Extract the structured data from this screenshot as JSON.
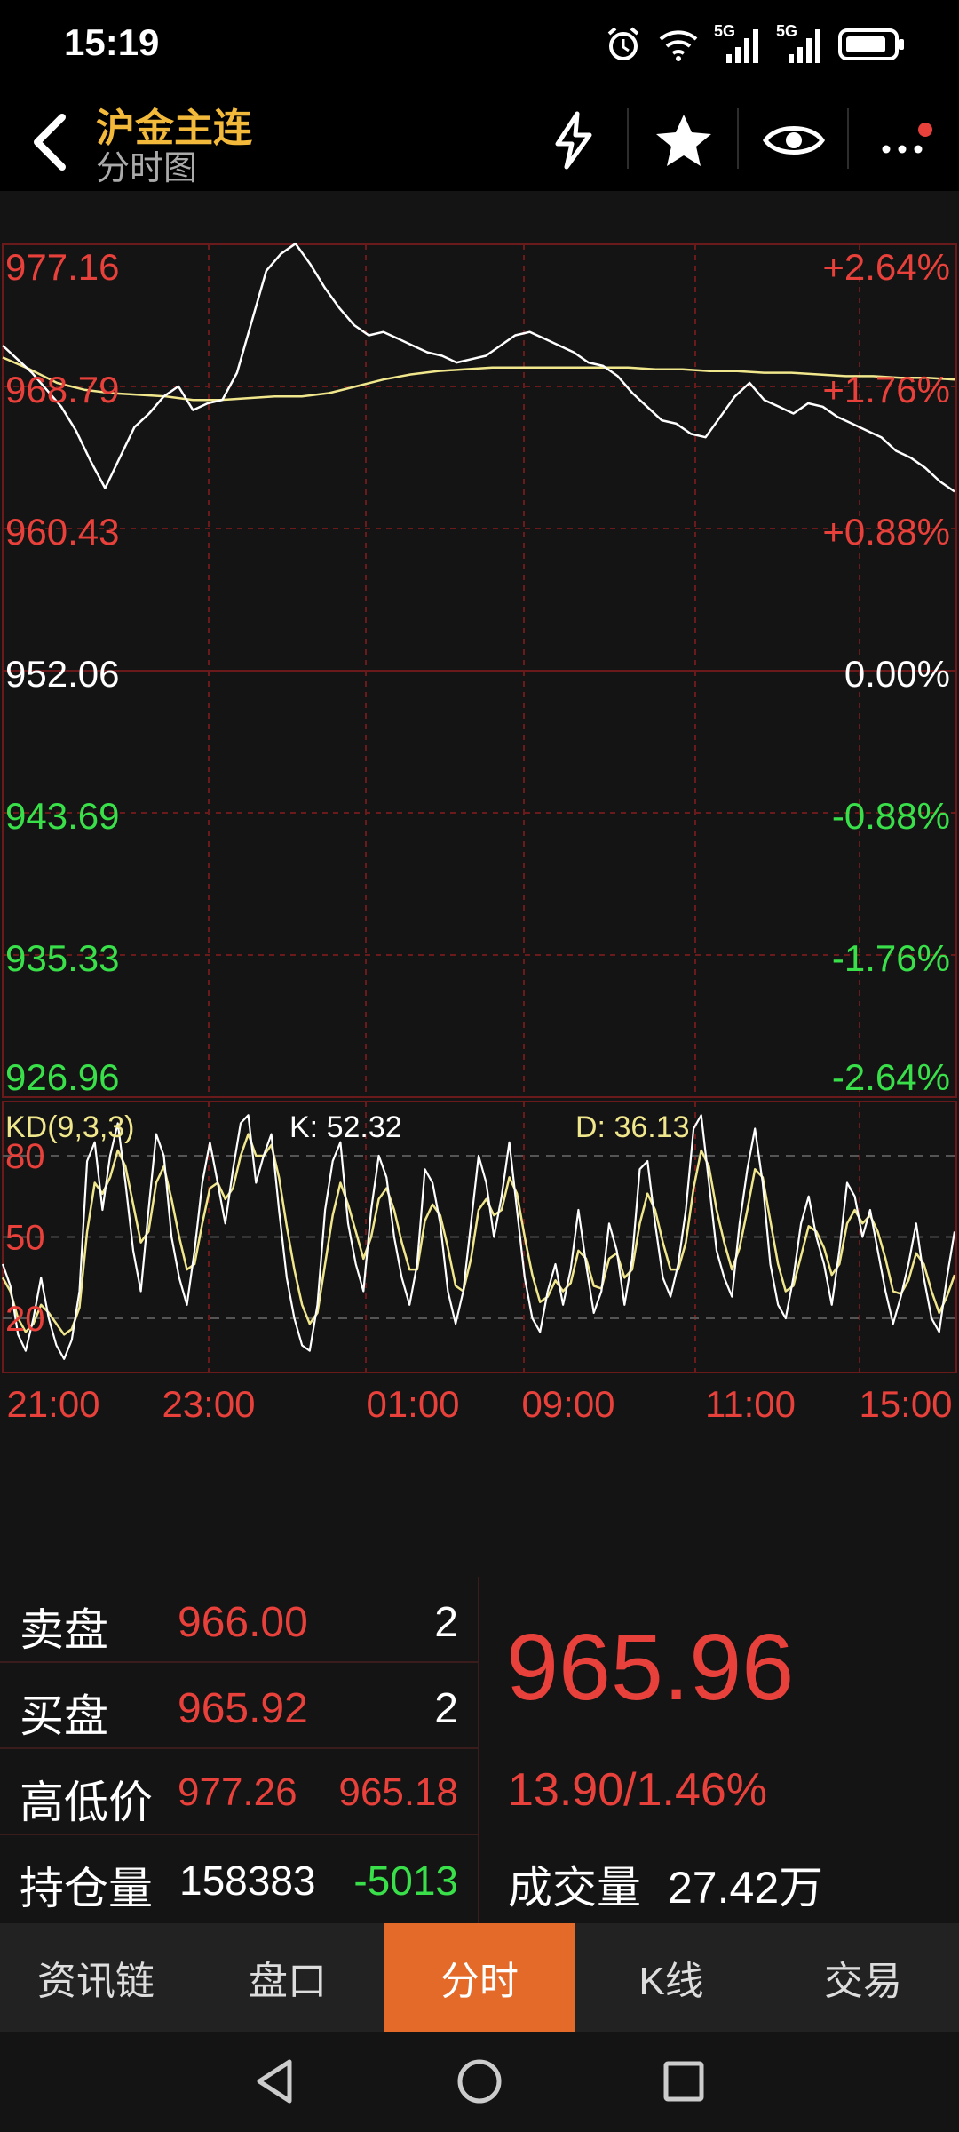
{
  "status": {
    "time": "15:19",
    "net1": "5G",
    "net2": "5G"
  },
  "header": {
    "title": "沪金主连",
    "subtitle": "分时图"
  },
  "chart_data": {
    "type": "line",
    "price_levels": [
      "977.16",
      "968.79",
      "960.43",
      "952.06",
      "943.69",
      "935.33",
      "926.96"
    ],
    "pct_levels": [
      "+2.64%",
      "+1.76%",
      "+0.88%",
      "0.00%",
      "-0.88%",
      "-1.76%",
      "-2.64%"
    ],
    "level_colors": [
      "#E8403A",
      "#E8403A",
      "#E8403A",
      "#ffffff",
      "#39E04A",
      "#39E04A",
      "#39E04A"
    ],
    "ylim": [
      926.96,
      977.16
    ],
    "time_labels": [
      "21:00",
      "23:00",
      "01:00",
      "09:00",
      "11:00",
      "15:00"
    ],
    "series": [
      {
        "values": [
          971.2,
          970.4,
          969.6,
          968.6,
          967.6,
          966.2,
          964.4,
          962.8,
          964.6,
          966.4,
          967.2,
          968.2,
          968.8,
          967.4,
          967.8,
          968.0,
          969.6,
          972.6,
          975.6,
          976.6,
          977.2,
          976.0,
          974.6,
          973.4,
          972.4,
          971.8,
          972.0,
          971.6,
          971.2,
          970.8,
          970.6,
          970.2,
          970.4,
          970.6,
          971.2,
          971.8,
          972.0,
          971.6,
          971.2,
          970.8,
          970.2,
          970.0,
          969.4,
          968.4,
          967.6,
          966.8,
          966.6,
          966.0,
          965.8,
          967.0,
          968.2,
          969.0,
          968.0,
          967.6,
          967.2,
          967.8,
          967.6,
          967.0,
          966.6,
          966.2,
          965.8,
          965.0,
          964.6,
          964.0,
          963.2,
          962.6
        ]
      },
      {
        "values": [
          970.5,
          969.8,
          969.0,
          968.6,
          968.4,
          968.3,
          968.2,
          968.0,
          968.0,
          968.1,
          968.2,
          968.2,
          968.4,
          968.8,
          969.2,
          969.5,
          969.7,
          969.8,
          969.9,
          969.9,
          969.9,
          969.9,
          969.9,
          969.9,
          969.8,
          969.8,
          969.7,
          969.7,
          969.6,
          969.6,
          969.5,
          969.4,
          969.4,
          969.3,
          969.3,
          969.2
        ]
      }
    ],
    "kd": {
      "label": "KD(9,3,3)",
      "k_label": "K: 52.32",
      "d_label": "D: 36.13",
      "levels": [
        "80",
        "50",
        "20"
      ],
      "ylim": [
        0,
        100
      ],
      "k": [
        40,
        32,
        14,
        8,
        20,
        35,
        20,
        10,
        5,
        12,
        30,
        78,
        85,
        60,
        80,
        92,
        70,
        45,
        30,
        60,
        88,
        80,
        50,
        35,
        25,
        45,
        70,
        85,
        70,
        55,
        75,
        92,
        95,
        70,
        80,
        88,
        60,
        35,
        20,
        10,
        8,
        25,
        60,
        78,
        85,
        55,
        40,
        30,
        60,
        80,
        72,
        50,
        35,
        25,
        40,
        75,
        70,
        55,
        30,
        18,
        30,
        55,
        80,
        70,
        50,
        65,
        85,
        60,
        35,
        20,
        15,
        30,
        40,
        25,
        38,
        60,
        40,
        22,
        30,
        55,
        45,
        25,
        42,
        75,
        78,
        55,
        35,
        28,
        40,
        60,
        90,
        95,
        70,
        45,
        35,
        28,
        55,
        75,
        90,
        70,
        40,
        25,
        20,
        35,
        55,
        65,
        50,
        40,
        25,
        45,
        70,
        65,
        50,
        60,
        45,
        30,
        18,
        28,
        40,
        55,
        35,
        20,
        15,
        35,
        52
      ],
      "d": [
        35,
        30,
        20,
        15,
        18,
        25,
        22,
        18,
        14,
        16,
        24,
        52,
        70,
        66,
        72,
        82,
        76,
        62,
        48,
        52,
        70,
        76,
        64,
        50,
        38,
        40,
        55,
        68,
        70,
        64,
        68,
        80,
        88,
        80,
        80,
        84,
        72,
        54,
        38,
        25,
        18,
        22,
        40,
        58,
        70,
        62,
        52,
        42,
        50,
        64,
        68,
        60,
        48,
        38,
        38,
        56,
        62,
        58,
        46,
        32,
        30,
        42,
        60,
        64,
        58,
        60,
        72,
        66,
        50,
        36,
        26,
        28,
        34,
        30,
        33,
        45,
        42,
        32,
        31,
        42,
        44,
        35,
        38,
        55,
        66,
        60,
        48,
        38,
        38,
        48,
        68,
        82,
        76,
        60,
        48,
        38,
        46,
        60,
        75,
        72,
        56,
        40,
        30,
        32,
        43,
        54,
        52,
        46,
        36,
        40,
        55,
        60,
        55,
        58,
        52,
        42,
        30,
        29,
        34,
        44,
        40,
        30,
        22,
        28,
        36
      ]
    }
  },
  "quote": {
    "ask_label": "卖盘",
    "ask_price": "966.00",
    "ask_qty": "2",
    "bid_label": "买盘",
    "bid_price": "965.92",
    "bid_qty": "2",
    "hl_label": "高低价",
    "high": "977.26",
    "low": "965.18",
    "oi_label": "持仓量",
    "oi": "158383",
    "oi_change": "-5013",
    "last": "965.96",
    "change": "13.90/1.46%",
    "vol_label": "成交量",
    "volume": "27.42万"
  },
  "tabs": [
    "资讯链",
    "盘口",
    "分时",
    "K线",
    "交易"
  ],
  "colors": {
    "up": "#E8403A",
    "down": "#39E04A",
    "accent": "#E46A2A",
    "title": "#F2B93A",
    "avg_line": "#F0E68C"
  }
}
